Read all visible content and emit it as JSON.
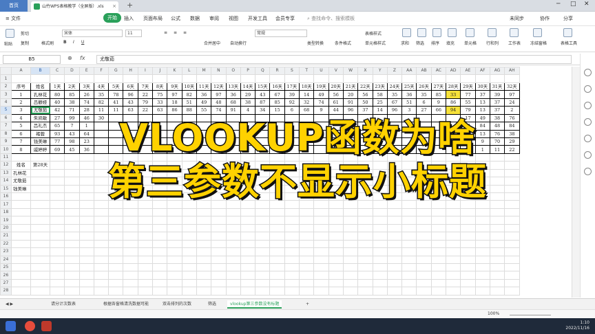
{
  "window": {
    "home_tab": "首页",
    "doc_tab": "山竹WPS表格教学（全屏版）.xls",
    "controls": [
      "─",
      "□",
      "✕"
    ]
  },
  "menu": {
    "file": "≡ 文件",
    "start": "开始",
    "items": [
      "插入",
      "页面布局",
      "公式",
      "数据",
      "审阅",
      "视图",
      "开发工具",
      "会员专享"
    ],
    "search_placeholder": "查找命令、搜索模板",
    "right": [
      "未同步",
      "协作",
      "分享"
    ]
  },
  "ribbon": {
    "font_name": "宋体",
    "font_size": "11",
    "number_format": "常规",
    "labels": [
      "粘贴",
      "剪切",
      "复制",
      "格式刷",
      "合并居中",
      "自动换行",
      "类型转换",
      "条件格式",
      "表格样式",
      "单元格样式",
      "求和",
      "筛选",
      "排序",
      "填充",
      "单元格",
      "行和列",
      "工作表",
      "冻结窗格",
      "表格工具"
    ]
  },
  "formula_bar": {
    "name_box": "B5",
    "fx": "fx",
    "value": "尤敬茹"
  },
  "sheet": {
    "columns": [
      "A",
      "B",
      "C",
      "D",
      "E",
      "F",
      "G",
      "H",
      "I",
      "J",
      "K",
      "L",
      "M",
      "N",
      "O",
      "P",
      "Q",
      "R",
      "S",
      "T",
      "U",
      "V",
      "W",
      "X",
      "Y",
      "Z",
      "AA",
      "AB",
      "AC",
      "AD",
      "AE",
      "AF",
      "AG",
      "AH"
    ],
    "header_row": [
      "序号",
      "姓名",
      "1天",
      "2天",
      "3天",
      "4天",
      "5天",
      "6天",
      "7天",
      "8天",
      "9天",
      "10天",
      "11天",
      "12天",
      "13天",
      "14天",
      "15天",
      "16天",
      "17天",
      "18天",
      "19天",
      "20天",
      "21天",
      "22天",
      "23天",
      "24天",
      "25天",
      "26天",
      "27天",
      "28天",
      "29天",
      "30天",
      "31天",
      "32天"
    ],
    "rows": [
      [
        "1",
        "孔林花",
        "80",
        "85",
        "26",
        "35",
        "78",
        "96",
        "22",
        "75",
        "97",
        "82",
        "36",
        "97",
        "36",
        "29",
        "43",
        "67",
        "39",
        "14",
        "49",
        "56",
        "20",
        "56",
        "58",
        "35",
        "36",
        "35",
        "85",
        "33",
        "77",
        "37",
        "39",
        "97"
      ],
      [
        "2",
        "吕静娅",
        "40",
        "38",
        "74",
        "82",
        "41",
        "43",
        "79",
        "33",
        "18",
        "51",
        "49",
        "48",
        "68",
        "38",
        "87",
        "85",
        "92",
        "32",
        "74",
        "61",
        "91",
        "50",
        "25",
        "67",
        "51",
        "6",
        "9",
        "86",
        "55",
        "13",
        "37",
        "24"
      ],
      [
        "3",
        "尤敬茹",
        "42",
        "71",
        "28",
        "11",
        "11",
        "63",
        "22",
        "63",
        "86",
        "88",
        "55",
        "74",
        "91",
        "4",
        "34",
        "15",
        "6",
        "68",
        "9",
        "44",
        "96",
        "37",
        "14",
        "96",
        "3",
        "27",
        "66",
        "94",
        "79",
        "13",
        "37",
        "2"
      ],
      [
        "4",
        "朱凯敏",
        "27",
        "99",
        "46",
        "30",
        "",
        "",
        "",
        "",
        "",
        "",
        "",
        "",
        "",
        "",
        "",
        "",
        "",
        "",
        "",
        "",
        "",
        "",
        "",
        "",
        "",
        "",
        "",
        "",
        "17",
        "49",
        "38",
        "76"
      ],
      [
        "5",
        "吕礼杰",
        "65",
        "7",
        "1",
        "",
        "",
        "",
        "",
        "",
        "",
        "",
        "",
        "",
        "",
        "",
        "",
        "",
        "",
        "",
        "",
        "",
        "",
        "",
        "",
        "",
        "",
        "",
        "",
        "",
        "21",
        "84",
        "48",
        "84"
      ],
      [
        "6",
        "褚蓉",
        "93",
        "43",
        "64",
        "",
        "",
        "",
        "",
        "",
        "",
        "",
        "",
        "",
        "",
        "",
        "",
        "",
        "",
        "",
        "",
        "",
        "",
        "",
        "",
        "",
        "",
        "",
        "",
        "",
        "40",
        "13",
        "76",
        "38"
      ],
      [
        "7",
        "钱美琳",
        "77",
        "98",
        "23",
        "",
        "",
        "",
        "",
        "",
        "",
        "",
        "",
        "",
        "",
        "",
        "",
        "",
        "",
        "",
        "",
        "",
        "",
        "",
        "",
        "",
        "",
        "",
        "",
        "",
        "37",
        "9",
        "70",
        "29"
      ],
      [
        "8",
        "戚婷婷",
        "69",
        "45",
        "36",
        "",
        "",
        "",
        "",
        "",
        "",
        "",
        "",
        "",
        "",
        "",
        "",
        "",
        "",
        "",
        "",
        "",
        "",
        "",
        "",
        "",
        "",
        "",
        "",
        "",
        "85",
        "1",
        "11",
        "22"
      ]
    ],
    "lookup_header": [
      "姓名",
      "第28天"
    ],
    "lookup_names": [
      "孔林花",
      "尤敬茹",
      "钱美琳"
    ]
  },
  "sheet_tabs": [
    "请分计次数表",
    "根据各窗格清洗数据可能",
    "双击排列的次数",
    "筛选",
    "vlookup第三参数没有标题"
  ],
  "status": {
    "zoom": "100%"
  },
  "taskbar": {
    "time": "1:10",
    "date": "2022/11/16"
  },
  "overlay": {
    "line1": "VLOOKUP函数为啥",
    "line2": "第三参数不显示小标题"
  }
}
